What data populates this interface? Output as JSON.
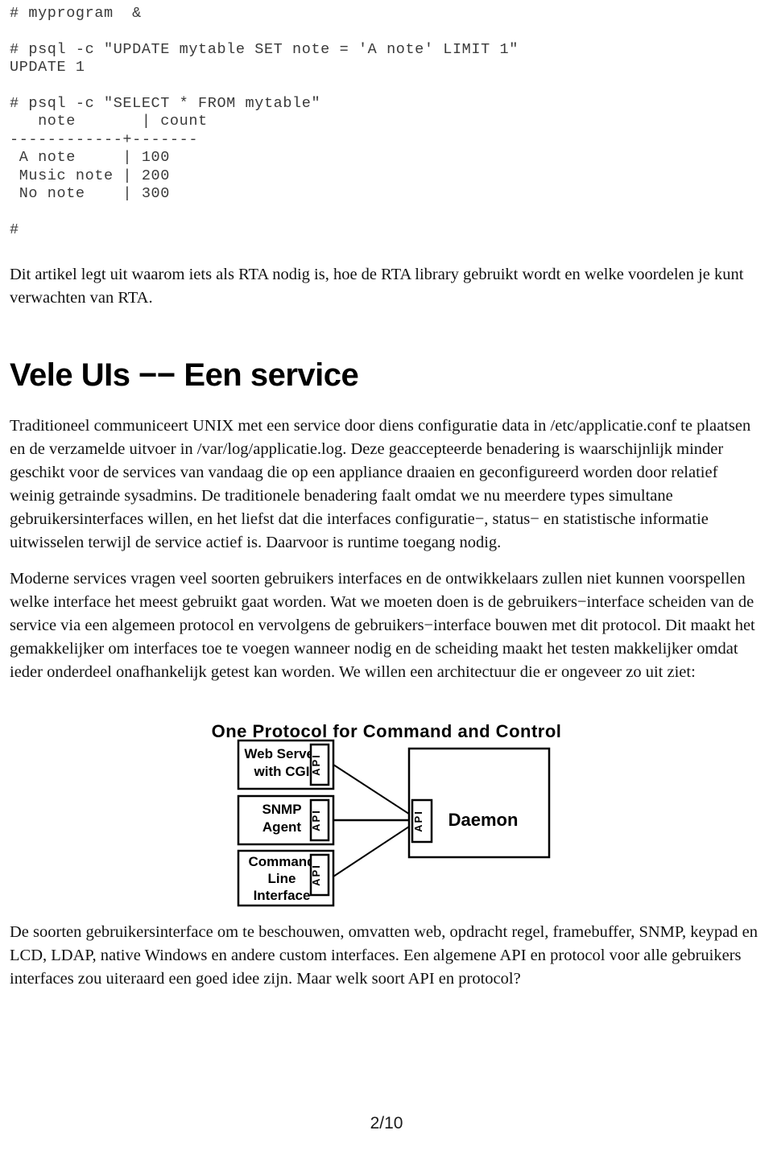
{
  "document": {
    "page_number": "2/10"
  },
  "terminal": {
    "lines": [
      "# myprogram  &",
      "",
      "# psql -c \"UPDATE mytable SET note = 'A note' LIMIT 1\"",
      "UPDATE 1",
      "",
      "# psql -c \"SELECT * FROM mytable\"",
      "   note       | count",
      "------------+-------",
      " A note     | 100",
      " Music note | 200",
      " No note    | 300",
      "",
      "#"
    ]
  },
  "intro": {
    "paragraph": "Dit artikel legt uit waarom iets als RTA nodig is, hoe de RTA library gebruikt wordt en welke voordelen je kunt verwachten van RTA."
  },
  "section": {
    "heading": "Vele UIs −− Een service",
    "paragraphs": [
      "Traditioneel communiceert UNIX met een service door diens configuratie data in /etc/applicatie.conf te plaatsen en de verzamelde uitvoer in /var/log/applicatie.log. Deze geaccepteerde benadering is waarschijnlijk minder geschikt voor de services van vandaag die op een appliance draaien en geconfigureerd worden door relatief weinig getrainde sysadmins. De traditionele benadering faalt omdat we nu meerdere types simultane gebruikersinterfaces willen, en het liefst dat die interfaces configuratie−, status− en statistische informatie uitwisselen terwijl de service actief is. Daarvoor is runtime toegang nodig.",
      "Moderne services vragen veel soorten gebruikers interfaces en de ontwikkelaars zullen niet kunnen voorspellen welke interface het meest gebruikt gaat worden. Wat we moeten doen is de gebruikers−interface scheiden van de service via een algemeen protocol en vervolgens de gebruikers−interface bouwen met dit protocol. Dit maakt het gemakkelijker om interfaces toe te voegen wanneer nodig en de scheiding maakt het testen makkelijker omdat ieder onderdeel onafhankelijk getest kan worden. We willen een architectuur die er ongeveer zo uit ziet:"
    ],
    "closing_paragraph": "De soorten gebruikersinterface om te beschouwen, omvatten web, opdracht regel, framebuffer, SNMP, keypad en LCD, LDAP, native Windows en andere custom interfaces. Een algemene API en protocol voor alle gebruikers interfaces zou uiteraard een goed idee zijn. Maar welk soort API en protocol?"
  },
  "figure": {
    "title": "One Protocol for Command and Control",
    "api_label": "API",
    "clients": [
      {
        "name": "web-server",
        "lines": [
          "Web Server",
          "with CGI"
        ]
      },
      {
        "name": "snmp-agent",
        "lines": [
          "SNMP",
          "Agent"
        ]
      },
      {
        "name": "command-line-interface",
        "lines": [
          "Command",
          "Line",
          "Interface"
        ]
      }
    ],
    "server": {
      "name": "daemon",
      "label": "Daemon"
    },
    "stroke_color": "#000000"
  }
}
